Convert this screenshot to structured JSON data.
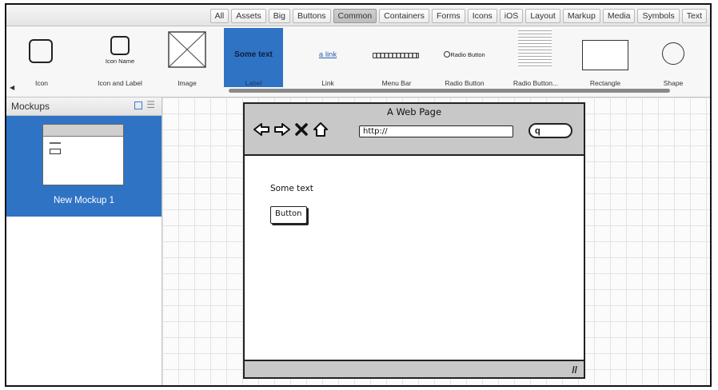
{
  "categories": [
    "All",
    "Assets",
    "Big",
    "Buttons",
    "Common",
    "Containers",
    "Forms",
    "Icons",
    "iOS",
    "Layout",
    "Markup",
    "Media",
    "Symbols",
    "Text"
  ],
  "active_category": "Common",
  "library": {
    "icon": "Icon",
    "icon_and_label": "Icon and Label",
    "icon_name_sample": "Icon Name",
    "image": "Image",
    "label": "Label",
    "label_sample": "Some text",
    "link": "Link",
    "link_sample": "a link",
    "menu_bar": "Menu Bar",
    "radio_button": "Radio Button",
    "radio_sample": "Radio Button",
    "radio_button_group": "Radio Button...",
    "rectangle": "Rectangle",
    "shape": "Shape"
  },
  "panel": {
    "title": "Mockups",
    "mockup_name": "New Mockup 1"
  },
  "mockup": {
    "page_title": "A Web Page",
    "url": "http://",
    "search_glyph": "q",
    "text": "Some text",
    "button": "Button"
  },
  "colors": {
    "selection": "#2f73c5",
    "browser_chrome": "#c8c8c8"
  }
}
